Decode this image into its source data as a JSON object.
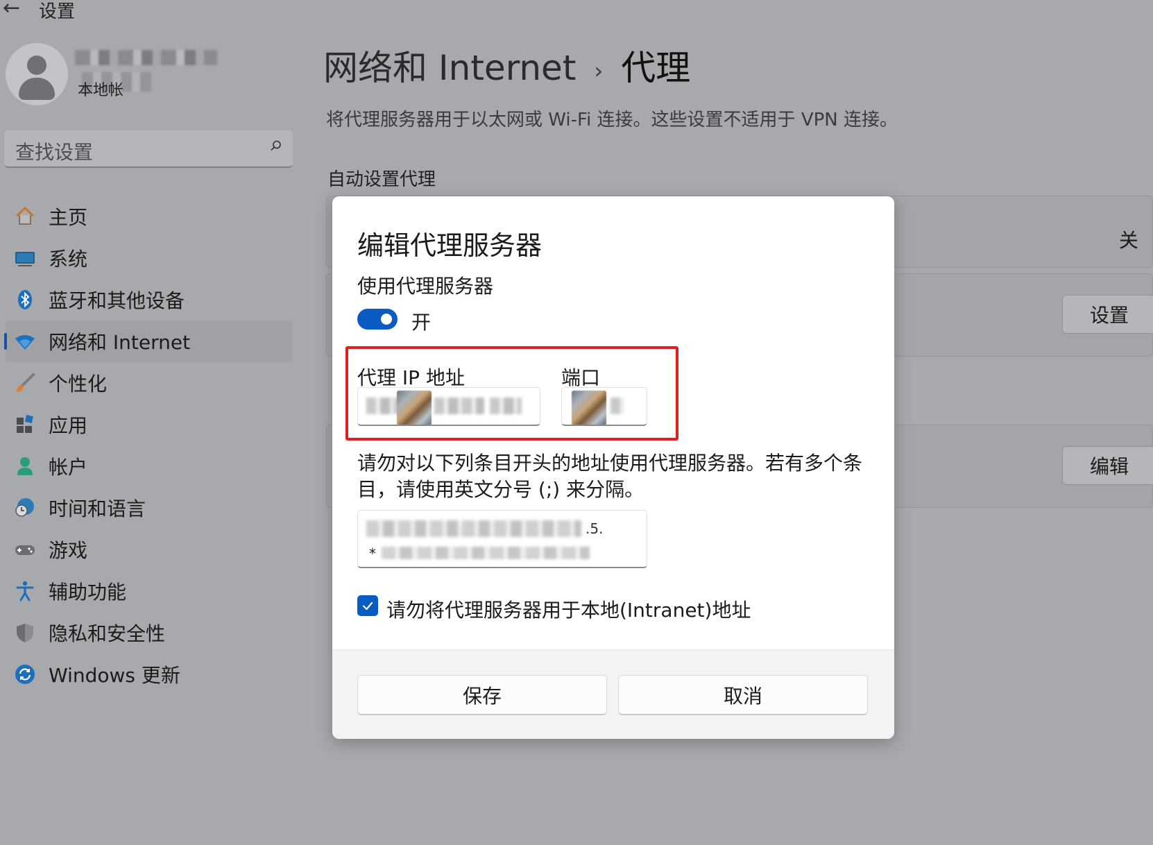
{
  "app": {
    "back_icon": "back-arrow-icon",
    "title": "设置"
  },
  "user": {
    "sub": "本地帐"
  },
  "search": {
    "placeholder": "查找设置"
  },
  "nav": {
    "items": [
      {
        "label": "主页",
        "icon": "home-icon"
      },
      {
        "label": "系统",
        "icon": "monitor-icon"
      },
      {
        "label": "蓝牙和其他设备",
        "icon": "bluetooth-icon"
      },
      {
        "label": "网络和 Internet",
        "icon": "wifi-icon",
        "active": true
      },
      {
        "label": "个性化",
        "icon": "brush-icon"
      },
      {
        "label": "应用",
        "icon": "apps-icon"
      },
      {
        "label": "帐户",
        "icon": "person-icon"
      },
      {
        "label": "时间和语言",
        "icon": "globe-clock-icon"
      },
      {
        "label": "游戏",
        "icon": "gamepad-icon"
      },
      {
        "label": "辅助功能",
        "icon": "accessibility-icon"
      },
      {
        "label": "隐私和安全性",
        "icon": "shield-icon"
      },
      {
        "label": "Windows 更新",
        "icon": "sync-icon"
      }
    ]
  },
  "breadcrumb": {
    "parent": "网络和 Internet",
    "separator": "›",
    "current": "代理"
  },
  "page": {
    "description": "将代理服务器用于以太网或 Wi-Fi 连接。这些设置不适用于 VPN 连接。",
    "auto_section": "自动设置代理",
    "auto_detect_state": "关",
    "setup_button": "设置",
    "edit_button": "编辑"
  },
  "dialog": {
    "title": "编辑代理服务器",
    "use_proxy_label": "使用代理服务器",
    "toggle_state": "开",
    "ip_label": "代理 IP 地址",
    "port_label": "端口",
    "exclude_description": "请勿对以下列条目开头的地址使用代理服务器。若有多个条目，请使用英文分号 (;) 来分隔。",
    "exclude_tail": ".5.",
    "exclude_star": "*",
    "bypass_local_label": "请勿将代理服务器用于本地(Intranet)地址",
    "bypass_local_checked": true,
    "save_button": "保存",
    "cancel_button": "取消"
  },
  "colors": {
    "accent": "#0a5cc2",
    "highlight": "#e02020",
    "backdrop": "#a7a9ad"
  }
}
